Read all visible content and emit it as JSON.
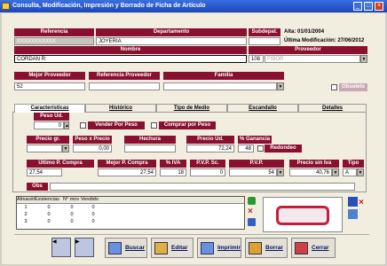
{
  "window": {
    "title": "Consulta, Modificación, Impresión y Borrado de Ficha de Artículo",
    "min": "_",
    "max": "□",
    "close": "×"
  },
  "header": {
    "referencia_label": "Referencia",
    "referencia_value": "XXXXXXXXXXX",
    "departamento_label": "Departamento",
    "departamento_value": "JOYERIA",
    "subdep_label": "Subdepat.",
    "alta": "Alta: 01/01/2004",
    "ultima_mod": "Última Modificación: 27/06/2012",
    "nombre_label": "Nombre",
    "nombre_value": "CORDAN R:",
    "proveedor_label": "Proveedor",
    "proveedor_code": "108",
    "proveedor_name": "FIBOR"
  },
  "row3": {
    "mejor_prov_label": "Mejor Proveedor",
    "mejor_prov_value": "52",
    "ref_prov_label": "Referencia Proveedor",
    "familia_label": "Familia",
    "obsoleto_label": "Obsoleto"
  },
  "tabs": [
    "Características",
    "Histórico",
    "Tipo de Medio",
    "Escandallo",
    "Detalles"
  ],
  "panel": {
    "peso_label": "Peso Ud.",
    "peso_value": "0",
    "vender_peso": "Vender Por Peso",
    "comprar_peso": "Comprar por Peso",
    "precio_gr_label": "Precio gr.",
    "peso_precio_label": "Peso x Precio",
    "peso_precio_value": "0,00",
    "hechura_label": "Hechura",
    "precio_ud_label": "Precio Ud.",
    "precio_ud_value": "72,24",
    "ganancia_label": "% Ganancia",
    "ganancia_value": "48",
    "redondeo_label": "Redondeo",
    "ultimo_label": "Último P. Compra",
    "ultimo_value": "27,54",
    "mejor_label": "Mejor P. Compra",
    "mejor_value": "27,54",
    "iva_label": "% IVA",
    "iva_value": "18",
    "pvp_sc_label": "P.V.P. Sc.",
    "pvp_sc_value": "0",
    "pvp_label": "P.V.P.",
    "pvp_value": "54",
    "precio_ref_label": "Precio sin Iva",
    "precio_ref_value": "40,76",
    "tipo_label": "Tipo",
    "tipo_value": "A",
    "obs_label": "Obs"
  },
  "grid": {
    "headers": [
      "Almacén",
      "Existencias",
      "N° mov",
      "Vendido"
    ],
    "rows": [
      [
        "1",
        "0",
        "0",
        "0"
      ],
      [
        "2",
        "0",
        "0",
        "0"
      ],
      [
        "3",
        "0",
        "0",
        "0"
      ]
    ]
  },
  "nav": {
    "prev": "◀",
    "next": "▶"
  },
  "buttons": {
    "buscar": "Buscar",
    "editar": "Editar",
    "imprimir": "Imprimir",
    "borrar": "Borrar",
    "cerrar": "Cerrar"
  },
  "colors": {
    "header": "#8a1030",
    "title": "#1a45b8"
  }
}
